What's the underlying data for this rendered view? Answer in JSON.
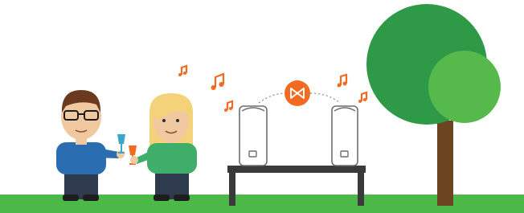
{
  "scene": {
    "description_free": true,
    "colors": {
      "ground": "#4cb848",
      "tree_dark": "#2e9a48",
      "tree_light": "#55b94c",
      "trunk": "#6b4422",
      "note": "#f26b21",
      "sync_badge": "#f26b21",
      "speaker_body": "#ffffff",
      "speaker_outline": "#6d6e71",
      "table": "#3a3a3a",
      "man_shirt": "#2a6db1",
      "man_hair": "#6b3a1e",
      "woman_shirt": "#3fae6a",
      "woman_hair": "#f4d27a",
      "pants": "#2e3a4d",
      "skin": "#f0c9a0",
      "glass_blue": "#3aa6c9",
      "glass_orange": "#f26b21"
    },
    "icons": {
      "music_notes": "music-note-icon",
      "sync": "bowtie-sync-icon"
    },
    "speakers_count": 2,
    "people_count": 2,
    "notes_count": 5
  }
}
